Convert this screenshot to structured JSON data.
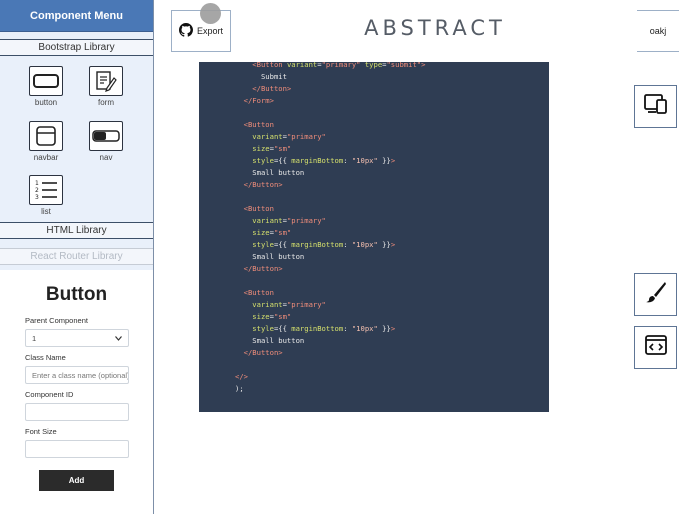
{
  "sidebar": {
    "title": "Component Menu",
    "libraries": {
      "bootstrap": "Bootstrap Library",
      "html": "HTML Library",
      "react_router": "React Router Library"
    },
    "components": [
      {
        "label": "button",
        "icon": "button-icon"
      },
      {
        "label": "form",
        "icon": "form-icon"
      },
      {
        "label": "navbar",
        "icon": "navbar-icon"
      },
      {
        "label": "nav",
        "icon": "nav-toggle-icon"
      },
      {
        "label": "list",
        "icon": "list-icon"
      }
    ]
  },
  "properties": {
    "title": "Button",
    "parent_component_label": "Parent Component",
    "parent_component_value": "1",
    "class_name_label": "Class Name",
    "class_name_placeholder": "Enter a class name (optional)",
    "component_id_label": "Component ID",
    "component_id_value": "",
    "font_size_label": "Font Size",
    "font_size_value": "",
    "add_label": "Add"
  },
  "header": {
    "export_label": "Export",
    "brand": "ABSTRACT",
    "user": "oakj"
  },
  "code_lines": [
    [
      [
        "tag",
        "    <Button "
      ],
      [
        "attr",
        "variant"
      ],
      [
        "br",
        "="
      ],
      [
        "str",
        "\"primary\""
      ],
      [
        "attr",
        " type"
      ],
      [
        "br",
        "="
      ],
      [
        "str",
        "\"submit\""
      ],
      [
        "tag",
        ">"
      ]
    ],
    [
      [
        "br",
        "      Submit"
      ]
    ],
    [
      [
        "tag",
        "    </Button>"
      ]
    ],
    [
      [
        "tag",
        "  </Form>"
      ]
    ],
    [
      [
        "br",
        ""
      ]
    ],
    [
      [
        "tag",
        "  <Button"
      ]
    ],
    [
      [
        "attr",
        "    variant"
      ],
      [
        "br",
        "="
      ],
      [
        "str",
        "\"primary\""
      ]
    ],
    [
      [
        "attr",
        "    size"
      ],
      [
        "br",
        "="
      ],
      [
        "str",
        "\"sm\""
      ]
    ],
    [
      [
        "attr",
        "    style"
      ],
      [
        "br",
        "={{ "
      ],
      [
        "attr",
        "marginBottom"
      ],
      [
        "br",
        ": "
      ],
      [
        "num",
        "\"10px\""
      ],
      [
        "br",
        " }}"
      ],
      [
        "tag",
        ">"
      ]
    ],
    [
      [
        "br",
        "    Small button"
      ]
    ],
    [
      [
        "tag",
        "  </Button>"
      ]
    ],
    [
      [
        "br",
        ""
      ]
    ],
    [
      [
        "tag",
        "  <Button"
      ]
    ],
    [
      [
        "attr",
        "    variant"
      ],
      [
        "br",
        "="
      ],
      [
        "str",
        "\"primary\""
      ]
    ],
    [
      [
        "attr",
        "    size"
      ],
      [
        "br",
        "="
      ],
      [
        "str",
        "\"sm\""
      ]
    ],
    [
      [
        "attr",
        "    style"
      ],
      [
        "br",
        "={{ "
      ],
      [
        "attr",
        "marginBottom"
      ],
      [
        "br",
        ": "
      ],
      [
        "num",
        "\"10px\""
      ],
      [
        "br",
        " }}"
      ],
      [
        "tag",
        ">"
      ]
    ],
    [
      [
        "br",
        "    Small button"
      ]
    ],
    [
      [
        "tag",
        "  </Button>"
      ]
    ],
    [
      [
        "br",
        ""
      ]
    ],
    [
      [
        "tag",
        "  <Button"
      ]
    ],
    [
      [
        "attr",
        "    variant"
      ],
      [
        "br",
        "="
      ],
      [
        "str",
        "\"primary\""
      ]
    ],
    [
      [
        "attr",
        "    size"
      ],
      [
        "br",
        "="
      ],
      [
        "str",
        "\"sm\""
      ]
    ],
    [
      [
        "attr",
        "    style"
      ],
      [
        "br",
        "={{ "
      ],
      [
        "attr",
        "marginBottom"
      ],
      [
        "br",
        ": "
      ],
      [
        "num",
        "\"10px\""
      ],
      [
        "br",
        " }}"
      ],
      [
        "tag",
        ">"
      ]
    ],
    [
      [
        "br",
        "    Small button"
      ]
    ],
    [
      [
        "tag",
        "  </Button>"
      ]
    ],
    [
      [
        "br",
        ""
      ]
    ],
    [
      [
        "tag",
        "</>"
      ]
    ],
    [
      [
        "br",
        ");"
      ]
    ]
  ],
  "right_toolbar": [
    "responsive-devices-icon",
    "paint-brush-icon",
    "code-window-icon"
  ]
}
